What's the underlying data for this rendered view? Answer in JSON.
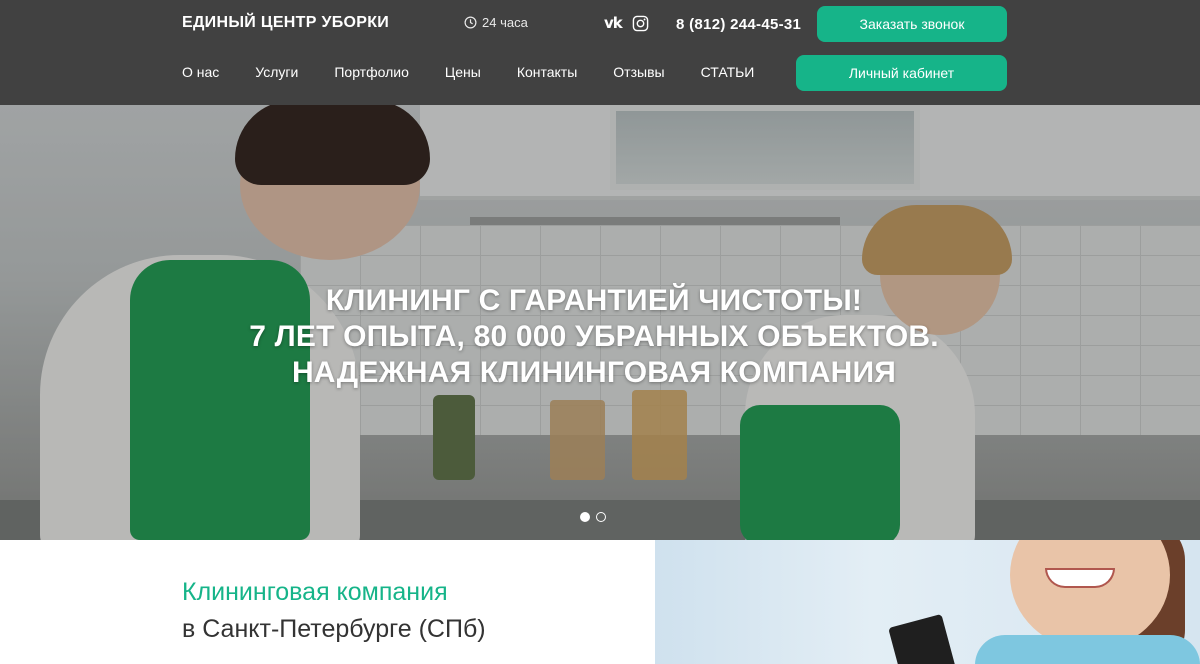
{
  "header": {
    "logo": "ЕДИНЫЙ ЦЕНТР УБОРКИ",
    "hours": "24 часа",
    "phone": "8 (812) 244-45-31",
    "call_button": "Заказать звонок",
    "cabinet_button": "Личный кабинет",
    "vk_label": "vk",
    "nav": [
      "О нас",
      "Услуги",
      "Портфолио",
      "Цены",
      "Контакты",
      "Отзывы",
      "СТАТЬИ"
    ]
  },
  "hero": {
    "line1": "КЛИНИНГ С ГАРАНТИЕЙ ЧИСТОТЫ!",
    "line2": "7 ЛЕТ ОПЫТА, 80 000 УБРАННЫХ ОБЪЕКТОВ.",
    "line3": "НАДЕЖНАЯ КЛИНИНГОВАЯ КОМПАНИЯ",
    "slides_total": 2,
    "active_slide": 1
  },
  "intro": {
    "title": "Клининговая компания",
    "subtitle": "в Санкт-Петербурге (СПб)"
  },
  "colors": {
    "header_bg": "#414141",
    "accent": "#16b489"
  }
}
